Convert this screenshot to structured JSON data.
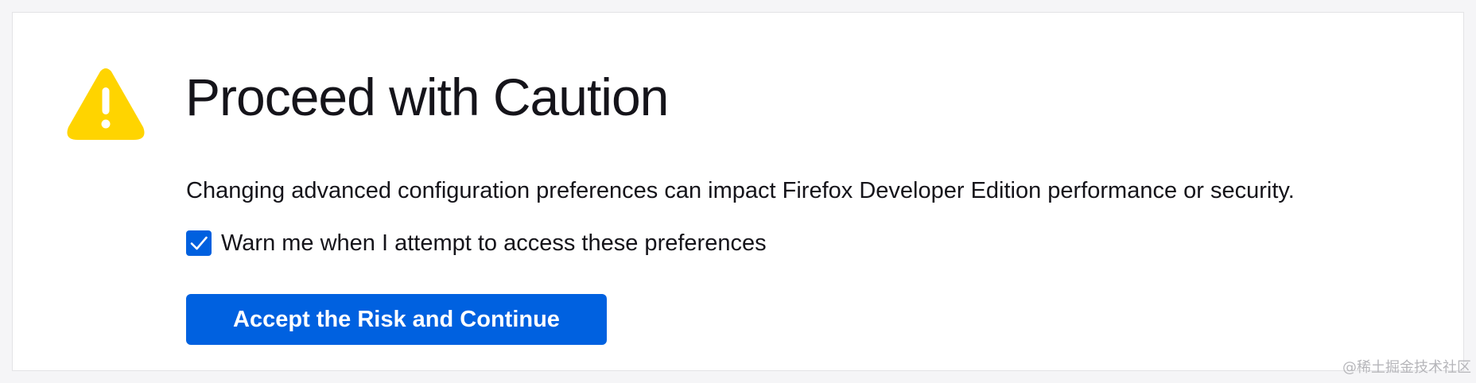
{
  "dialog": {
    "icon": "warning-icon",
    "title": "Proceed with Caution",
    "description": "Changing advanced configuration preferences can impact Firefox Developer Edition performance or security.",
    "warn_checkbox": {
      "label": "Warn me when I attempt to access these preferences",
      "checked": true
    },
    "accept_button_label": "Accept the Risk and Continue"
  },
  "watermark": "@稀土掘金技术社区",
  "colors": {
    "warning_yellow": "#ffd400",
    "accent_blue": "#0061e0",
    "text": "#15141a",
    "background": "#f5f5f7"
  }
}
